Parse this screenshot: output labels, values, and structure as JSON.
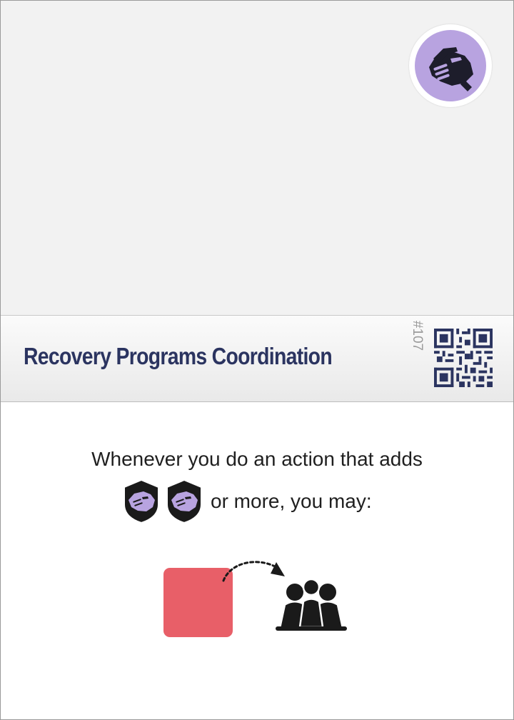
{
  "card": {
    "title": "Recovery Programs Coordination",
    "number": "#107",
    "category_icon": "handshake-icon",
    "colors": {
      "title": "#2b3460",
      "badge": "#b8a3e0",
      "cube": "#e85f68",
      "art_background": "#f2f2f2"
    }
  },
  "rules": {
    "line1": "Whenever you do an action that adds",
    "line2": "or more, you may:",
    "cost_icons": [
      "handshake-shield-icon",
      "handshake-shield-icon"
    ],
    "effect": {
      "from": "red-cube",
      "arrow": "dotted-arrow-icon",
      "to": "people-group-icon"
    }
  }
}
